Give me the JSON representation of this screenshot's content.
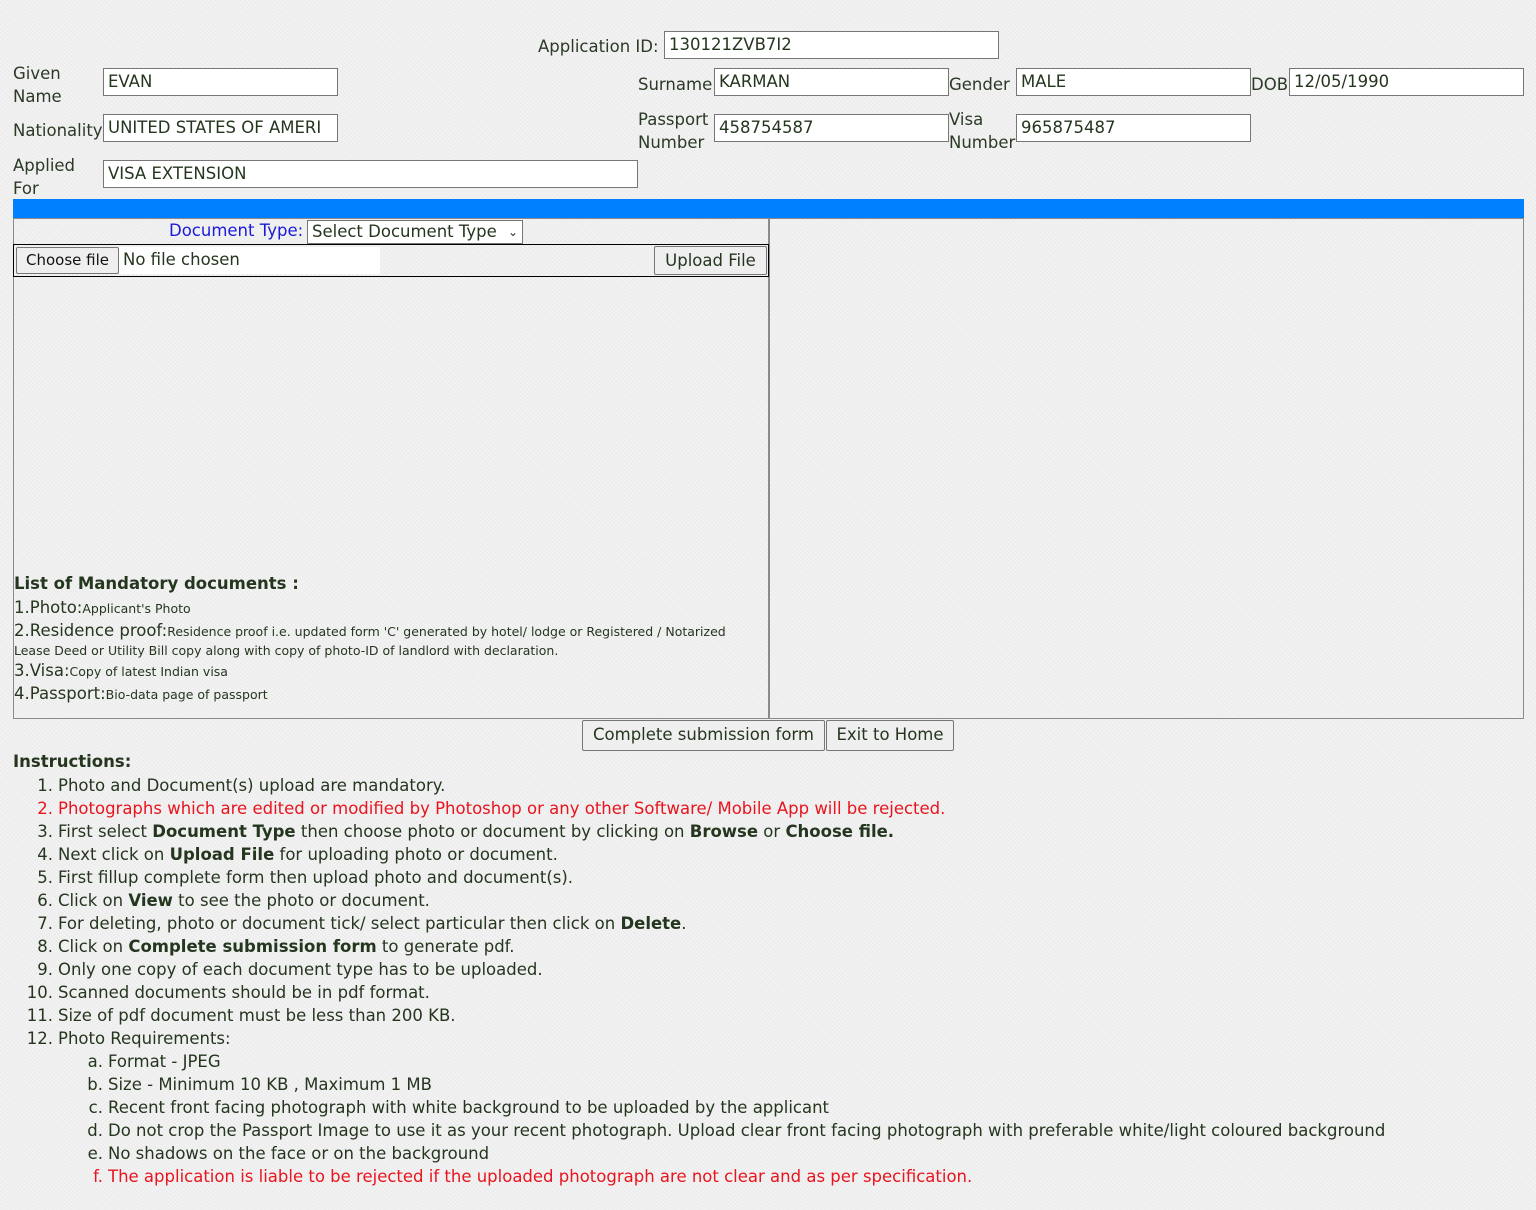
{
  "form": {
    "application_id_label": "Application ID:",
    "application_id": "130121ZVB7I2",
    "given_name_label_1": "Given",
    "given_name_label_2": "Name",
    "given_name": "EVAN",
    "surname_label": "Surname",
    "surname": "KARMAN",
    "gender_label": "Gender",
    "gender": "MALE",
    "dob_label": "DOB",
    "dob": "12/05/1990",
    "nationality_label": "Nationality",
    "nationality": "UNITED STATES OF AMERI",
    "passport_label_1": "Passport",
    "passport_label_2": "Number",
    "passport_number": "458754587",
    "visa_label_1": "Visa",
    "visa_label_2": "Number",
    "visa_number": "965875487",
    "applied_for_label_1": "Applied",
    "applied_for_label_2": "For",
    "applied_for": "VISA EXTENSION"
  },
  "upload": {
    "document_type_label": "Document Type:",
    "document_type_selected": "Select Document Type",
    "choose_file_label": "Choose file",
    "no_file_text": "No file chosen",
    "upload_button": "Upload File"
  },
  "mandatory": {
    "title": "List of Mandatory documents :",
    "items": [
      {
        "head": "1.Photo:",
        "desc": "Applicant's Photo"
      },
      {
        "head": "2.Residence proof:",
        "desc": "Residence proof i.e. updated form 'C' generated by hotel/ lodge or Registered / Notarized Lease Deed or Utility Bill copy along with copy of photo-ID of landlord with declaration."
      },
      {
        "head": "3.Visa:",
        "desc": "Copy of latest Indian visa"
      },
      {
        "head": "4.Passport:",
        "desc": "Bio-data page of passport"
      }
    ]
  },
  "actions": {
    "complete_button": "Complete submission form",
    "exit_button": "Exit to Home"
  },
  "instructions": {
    "title": "Instructions:",
    "items": [
      {
        "num": "1.",
        "parts": [
          {
            "t": "Photo and Document(s) upload are mandatory."
          }
        ]
      },
      {
        "num": "2.",
        "red": true,
        "parts": [
          {
            "t": "Photographs which are edited or modified by Photoshop or any other Software/ Mobile App will be rejected."
          }
        ]
      },
      {
        "num": "3.",
        "parts": [
          {
            "t": "First select "
          },
          {
            "t": "Document Type",
            "b": true
          },
          {
            "t": " then choose photo or document by clicking on "
          },
          {
            "t": "Browse",
            "b": true
          },
          {
            "t": " or "
          },
          {
            "t": "Choose file.",
            "b": true
          }
        ]
      },
      {
        "num": "4.",
        "parts": [
          {
            "t": "Next click on "
          },
          {
            "t": "Upload File",
            "b": true
          },
          {
            "t": " for uploading photo or document."
          }
        ]
      },
      {
        "num": "5.",
        "parts": [
          {
            "t": "First fillup complete form then upload photo and document(s)."
          }
        ]
      },
      {
        "num": "6.",
        "parts": [
          {
            "t": "Click on "
          },
          {
            "t": "View",
            "b": true
          },
          {
            "t": " to see the photo or document."
          }
        ]
      },
      {
        "num": "7.",
        "parts": [
          {
            "t": "For deleting, photo or document tick/ select particular then click on "
          },
          {
            "t": "Delete",
            "b": true
          },
          {
            "t": "."
          }
        ]
      },
      {
        "num": "8.",
        "parts": [
          {
            "t": "Click on "
          },
          {
            "t": "Complete submission form",
            "b": true
          },
          {
            "t": " to generate pdf."
          }
        ]
      },
      {
        "num": "9.",
        "parts": [
          {
            "t": "Only one copy of each document type has to be uploaded."
          }
        ]
      },
      {
        "num": "10.",
        "parts": [
          {
            "t": "Scanned documents should be in pdf format."
          }
        ]
      },
      {
        "num": "11.",
        "parts": [
          {
            "t": "Size of pdf document must be less than 200 KB."
          }
        ]
      },
      {
        "num": "12.",
        "parts": [
          {
            "t": "Photo Requirements:"
          }
        ]
      }
    ],
    "photo_requirements": [
      {
        "num": "a.",
        "text": "Format - JPEG"
      },
      {
        "num": "b.",
        "text": "Size - Minimum 10 KB , Maximum 1 MB"
      },
      {
        "num": "c.",
        "text": "Recent front facing photograph with white background to be uploaded by the applicant"
      },
      {
        "num": "d.",
        "text": "Do not crop the Passport Image to use it as your recent photograph. Upload clear front facing photograph with preferable white/light coloured background"
      },
      {
        "num": "e.",
        "text": "No shadows on the face or on the background"
      },
      {
        "num": "f.",
        "text": "The application is liable to be rejected if the uploaded photograph are not clear and as per specification.",
        "red": true
      }
    ]
  },
  "colors": {
    "accent_bar": "#0080ff",
    "warning_text": "#e8141e",
    "doc_type_label": "#1a1ad8"
  }
}
